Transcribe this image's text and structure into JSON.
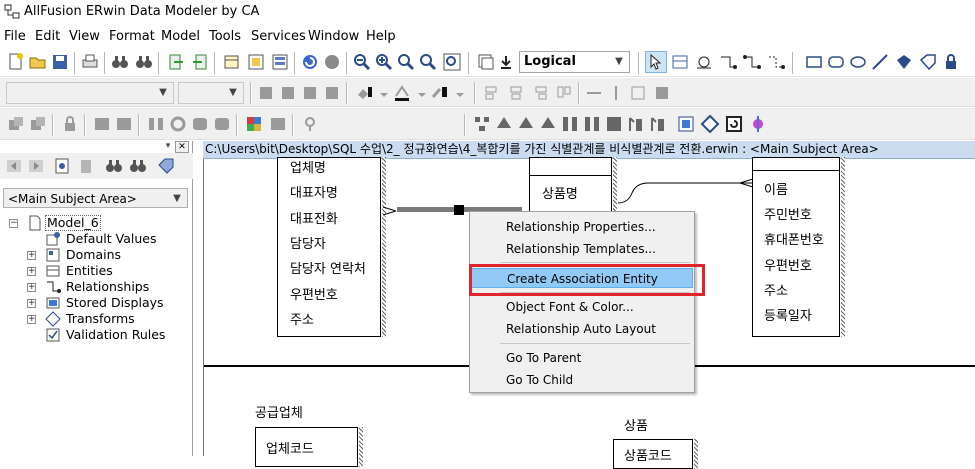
{
  "window": {
    "title": "AllFusion ERwin Data Modeler by CA"
  },
  "menu": [
    "File",
    "Edit",
    "View",
    "Format",
    "Model",
    "Tools",
    "Services",
    "Window",
    "Help"
  ],
  "toolbar": {
    "display_level": "Logical"
  },
  "left_pane": {
    "subject_area": "<Main Subject Area>",
    "tree": [
      {
        "label": "Model_6",
        "icon": "model-icon",
        "expander": "minus",
        "level": 0
      },
      {
        "label": "Default Values",
        "icon": "default-values-icon",
        "expander": "",
        "level": 1
      },
      {
        "label": "Domains",
        "icon": "domains-icon",
        "expander": "plus",
        "level": 1
      },
      {
        "label": "Entities",
        "icon": "entities-icon",
        "expander": "plus",
        "level": 1
      },
      {
        "label": "Relationships",
        "icon": "relationships-icon",
        "expander": "plus",
        "level": 1
      },
      {
        "label": "Stored Displays",
        "icon": "stored-displays-icon",
        "expander": "plus",
        "level": 1
      },
      {
        "label": "Transforms",
        "icon": "transforms-icon",
        "expander": "plus",
        "level": 1
      },
      {
        "label": "Validation Rules",
        "icon": "validation-rules-icon",
        "expander": "",
        "level": 1
      }
    ]
  },
  "path_bar": "C:\\Users\\bit\\Desktop\\SQL 수업\\2_ 정규화연습\\4_복합키를 가진 식별관계를 비식별관계로 전환.erwin : <Main Subject Area>",
  "canvas": {
    "entity_top_left_attrs": [
      "업체명",
      "대표자명",
      "대표전화",
      "담당자",
      "담당자 연락처",
      "우편번호",
      "주소"
    ],
    "entity_top_mid_attr": "상품명",
    "entity_top_right_attrs": [
      "이름",
      "주민번호",
      "휴대폰번호",
      "우편번호",
      "주소",
      "등록일자"
    ],
    "entity_bottom_left_title": "공급업체",
    "entity_bottom_left_attr": "업체코드",
    "entity_bottom_right_title": "상품",
    "entity_bottom_right_attr": "상품코드"
  },
  "context_menu": {
    "items": [
      "Relationship Properties...",
      "Relationship Templates...",
      "Create Association Entity",
      "Object Font & Color...",
      "Relationship Auto Layout",
      "Go To Parent",
      "Go To Child"
    ],
    "highlighted": "Create Association Entity"
  },
  "colors": {
    "highlight": "#91c9f7",
    "red_box": "#e3242b",
    "path_bar": "#cbdcf1"
  }
}
